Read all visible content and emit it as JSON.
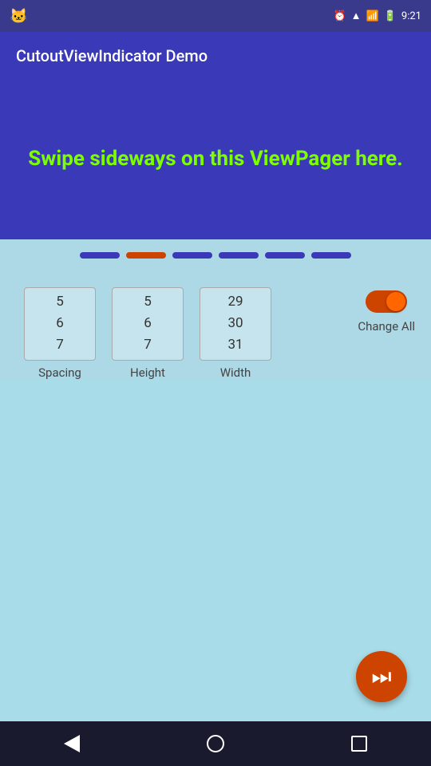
{
  "statusBar": {
    "time": "9:21",
    "catIcon": "🐱"
  },
  "appBar": {
    "title": "CutoutViewIndicator Demo"
  },
  "viewpager": {
    "text": "Swipe sideways on this ViewPager here."
  },
  "indicators": [
    {
      "active": false
    },
    {
      "active": true
    },
    {
      "active": false
    },
    {
      "active": false
    },
    {
      "active": false
    },
    {
      "active": false
    }
  ],
  "controls": {
    "spacing": {
      "label": "Spacing",
      "values": [
        "5",
        "6",
        "7"
      ]
    },
    "height": {
      "label": "Height",
      "values": [
        "5",
        "6",
        "7"
      ]
    },
    "width": {
      "label": "Width",
      "values": [
        "29",
        "30",
        "31"
      ]
    },
    "toggleLabel": "Change All"
  },
  "fab": {
    "icon": "⏭"
  },
  "bottomNav": {
    "back": "back",
    "home": "home",
    "recents": "recents"
  }
}
